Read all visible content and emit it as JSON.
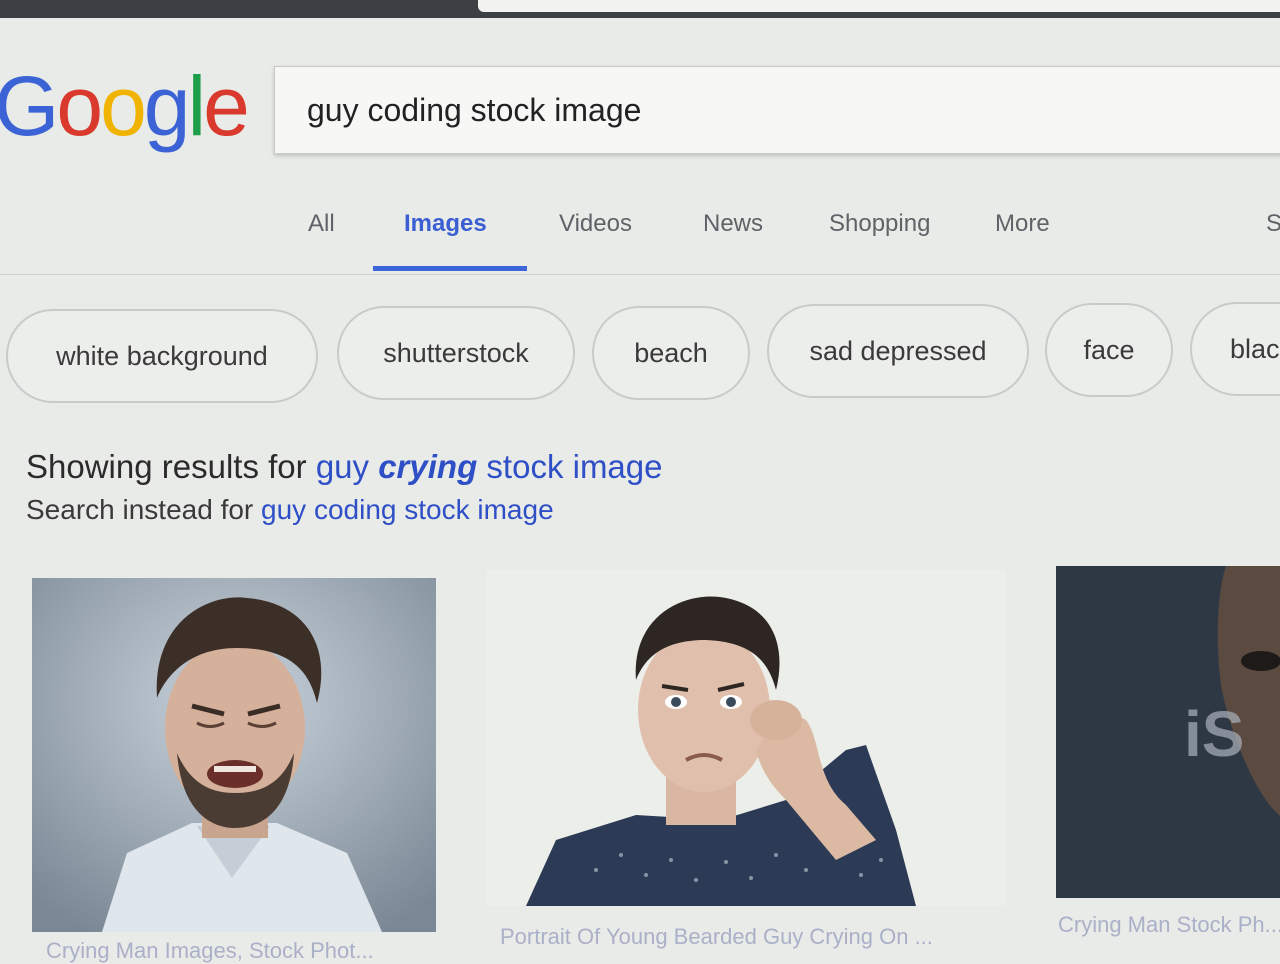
{
  "logo": {
    "letters": [
      "G",
      "o",
      "o",
      "g",
      "l",
      "e"
    ],
    "colors": [
      "#3b63d6",
      "#d93a2d",
      "#f0b400",
      "#3b63d6",
      "#1e9e4a",
      "#d93a2d"
    ]
  },
  "search": {
    "query": "guy coding stock image"
  },
  "tabs": [
    {
      "label": "All"
    },
    {
      "label": "Images"
    },
    {
      "label": "Videos"
    },
    {
      "label": "News"
    },
    {
      "label": "Shopping"
    },
    {
      "label": "More"
    },
    {
      "label": "S"
    }
  ],
  "chips": [
    {
      "label": "white background"
    },
    {
      "label": "shutterstock"
    },
    {
      "label": "beach"
    },
    {
      "label": "sad depressed"
    },
    {
      "label": "face"
    },
    {
      "label": "blac"
    }
  ],
  "correction": {
    "prefix": "Showing results for ",
    "guy": "guy",
    "corrected_word": "crying",
    "rest": "stock image",
    "instead_prefix": "Search instead for ",
    "original_query": "guy coding stock image"
  },
  "results": [
    {
      "caption": "Crying Man Images, Stock Phot..."
    },
    {
      "caption": "Portrait Of Young Bearded Guy Crying On ..."
    },
    {
      "caption": "Crying Man Stock Ph...",
      "watermark": "iS"
    }
  ],
  "colors": {
    "accent": "#3b65d9",
    "link": "#2f4fc7"
  }
}
